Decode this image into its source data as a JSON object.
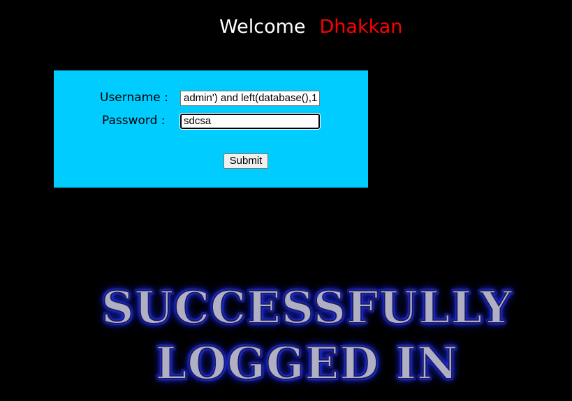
{
  "header": {
    "welcome": "Welcome",
    "name": "Dhakkan"
  },
  "login_form": {
    "username_label": "Username :",
    "username_value": "admin') and left(database(),1",
    "password_label": "Password :",
    "password_value": "sdcsa",
    "submit_label": "Submit"
  },
  "result_banner": {
    "line1": "SUCCESSFULLY",
    "line2": "LOGGED IN"
  },
  "colors": {
    "background": "#000000",
    "form_background": "#00ccff",
    "name_color": "#ff0000",
    "banner_glow": "#2233ff"
  }
}
